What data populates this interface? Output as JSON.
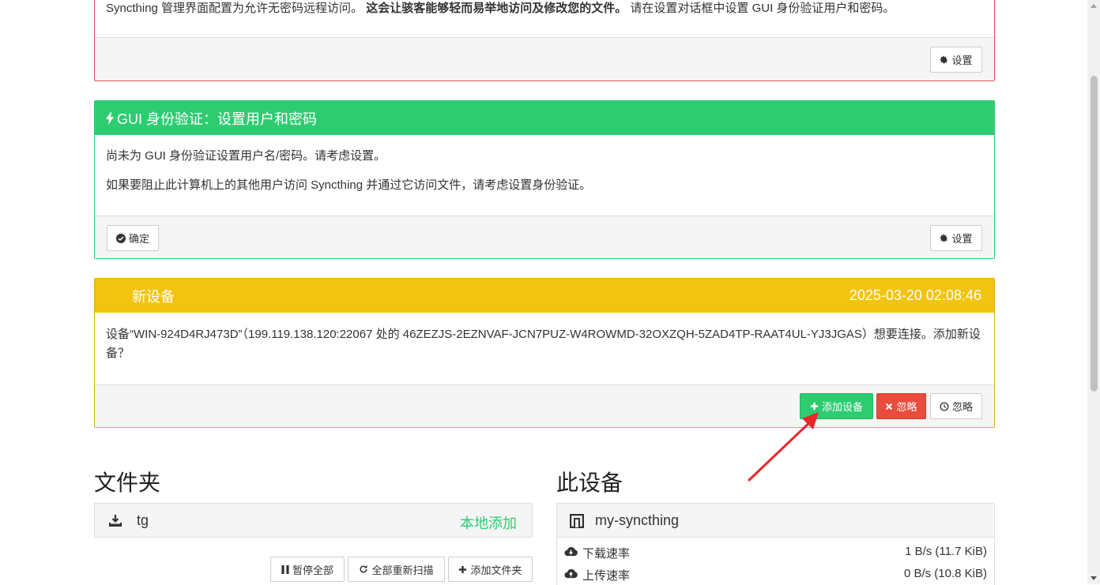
{
  "warning_panel": {
    "text_normal_1": "Syncthing 管理界面配置为允许无密码远程访问。",
    "text_bold": "这会让骇客能够轻而易举地访问及修改您的文件。",
    "text_normal_2": "请在设置对话框中设置 GUI 身份验证用户和密码。",
    "settings_button": "设置"
  },
  "auth_panel": {
    "title": "GUI 身份验证：设置用户和密码",
    "line1": "尚未为 GUI 身份验证设置用户名/密码。请考虑设置。",
    "line2": "如果要阻止此计算机上的其他用户访问 Syncthing 并通过它访问文件，请考虑设置身份验证。",
    "ok_button": "确定",
    "settings_button": "设置"
  },
  "new_device_panel": {
    "title": "新设备",
    "timestamp": "2025-03-20 02:08:46",
    "message": "设备“WIN-924D4RJ473D”（199.119.138.120:22067 处的 46ZEZJS-2EZNVAF-JCN7PUZ-W4ROWMD-32OXZQH-5ZAD4TP-RAAT4UL-YJ3JGAS）想要连接。添加新设备？",
    "add_button": "添加设备",
    "ignore_button": "忽略",
    "later_button": "忽略"
  },
  "folders": {
    "heading": "文件夹",
    "items": [
      {
        "name": "tg",
        "status": "本地添加"
      }
    ],
    "pause_all": "暂停全部",
    "rescan_all": "全部重新扫描",
    "add_folder": "添加文件夹"
  },
  "this_device": {
    "heading": "此设备",
    "name": "my-syncthing",
    "download_label": "下载速率",
    "download_value": "1 B/s (11.7 KiB)",
    "upload_label": "上传速率",
    "upload_value": "0 B/s (10.8 KiB)"
  },
  "colors": {
    "success": "#2ecc71",
    "danger": "#e74c3c",
    "warning": "#f1c40f",
    "arrow": "#e8282b"
  },
  "icons": [
    "gear-icon",
    "bolt-icon",
    "check-circle-icon",
    "plus-icon",
    "times-icon",
    "clock-icon",
    "download-icon",
    "qrcode-icon",
    "cloud-download-icon",
    "cloud-upload-icon",
    "pause-icon",
    "refresh-icon"
  ]
}
